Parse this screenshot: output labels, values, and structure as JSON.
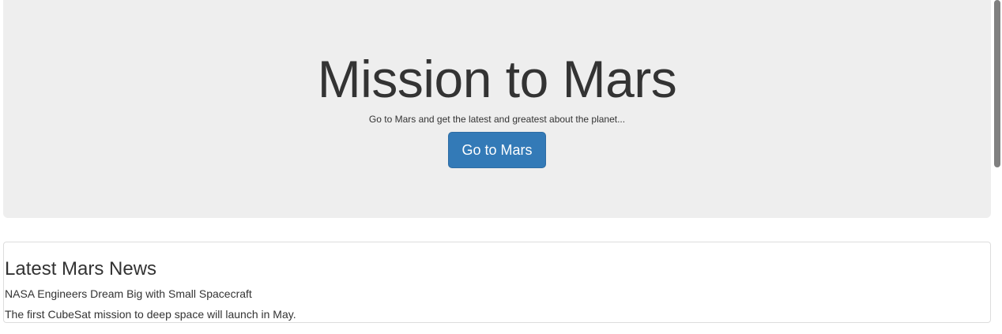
{
  "jumbotron": {
    "title": "Mission to Mars",
    "subtitle": "Go to Mars and get the latest and greatest about the planet...",
    "button_label": "Go to Mars",
    "button_color": "#337ab7",
    "background_color": "#eeeeee"
  },
  "news": {
    "heading": "Latest Mars News",
    "title": "NASA Engineers Dream Big with Small Spacecraft",
    "paragraph": "The first CubeSat mission to deep space will launch in May."
  },
  "scrollbar": {
    "position_fraction": 0.0,
    "visible_fraction": 0.5
  }
}
